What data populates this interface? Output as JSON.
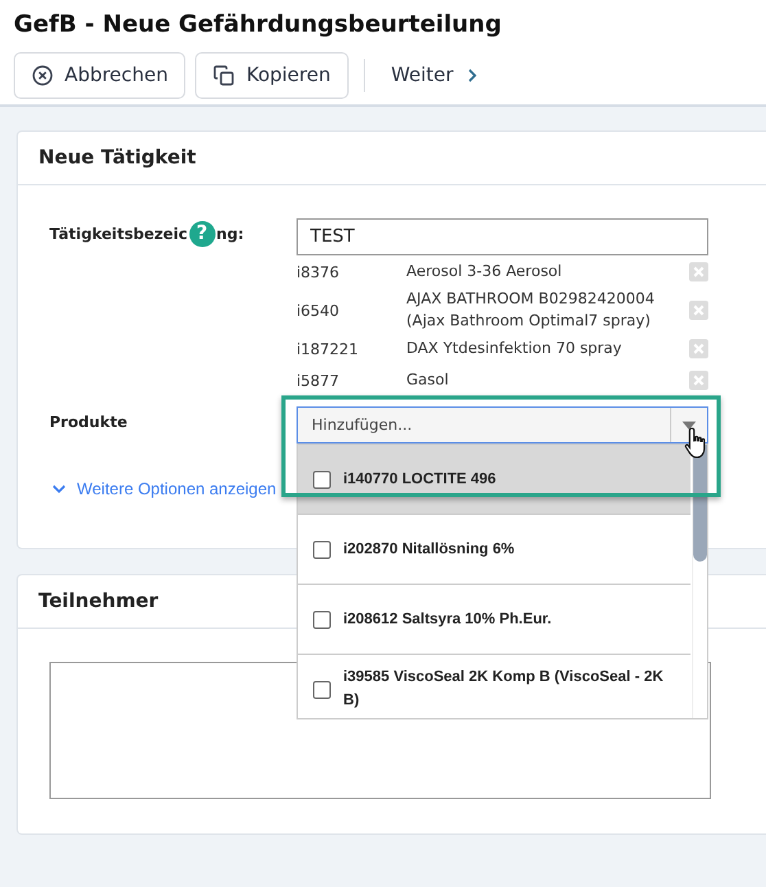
{
  "title": "GefB - Neue Gefährdungsbeurteilung",
  "toolbar": [
    {
      "label": "Abbrechen",
      "kind": "cancel"
    },
    {
      "label": "Kopieren",
      "kind": "copy"
    },
    {
      "label": "Weiter",
      "kind": "next"
    }
  ],
  "activity": {
    "heading": "Neue Tätigkeit",
    "label_start": "Tätigkeitsbezeic",
    "label_end": "ng:",
    "help_icon": "?",
    "name_value": "TEST",
    "products_label": "Produkte",
    "products": [
      {
        "id": "i8376",
        "name": "Aerosol 3-36 Aerosol"
      },
      {
        "id": "i6540",
        "name": "AJAX BATHROOM B02982420004 (Ajax Bathroom Optimal7 spray)"
      },
      {
        "id": "i187221",
        "name": "DAX Ytdesinfektion 70 spray"
      },
      {
        "id": "i5877",
        "name": "Gasol"
      }
    ],
    "add_placeholder": "Hinzufügen...",
    "more_options": "Weitere Optionen anzeigen",
    "dropdown": [
      {
        "label": "i140770 LOCTITE 496",
        "checked": false,
        "selected": true
      },
      {
        "label": "i202870 Nitallösning 6%",
        "checked": false,
        "selected": false
      },
      {
        "label": "i208612 Saltsyra 10% Ph.Eur.",
        "checked": false,
        "selected": false
      },
      {
        "label": "i39585 ViscoSeal 2K Komp B (ViscoSeal - 2K B)",
        "checked": false,
        "selected": false
      }
    ]
  },
  "participants": {
    "heading": "Teilnehmer"
  }
}
